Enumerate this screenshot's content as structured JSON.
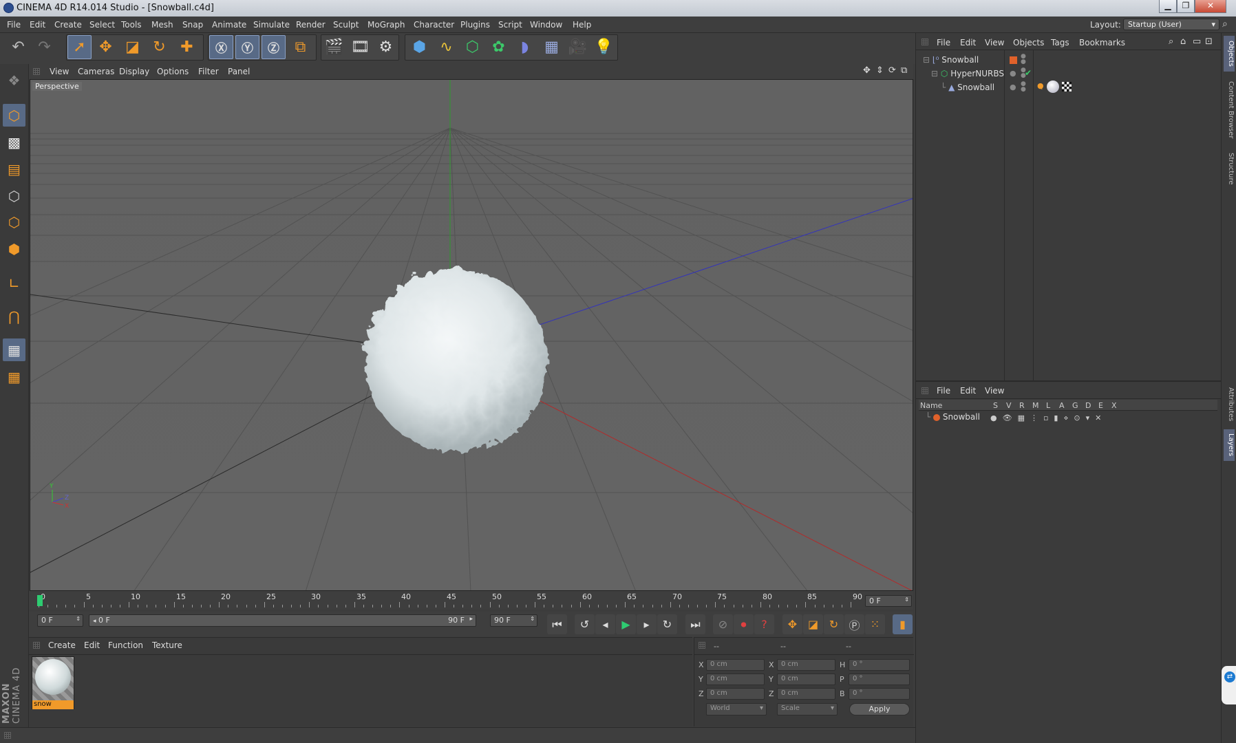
{
  "window": {
    "title": "CINEMA 4D R14.014 Studio - [Snowball.c4d]"
  },
  "menu": [
    "File",
    "Edit",
    "Create",
    "Select",
    "Tools",
    "Mesh",
    "Snap",
    "Animate",
    "Simulate",
    "Render",
    "Sculpt",
    "MoGraph",
    "Character",
    "Plugins",
    "Script",
    "Window",
    "Help"
  ],
  "layout": {
    "label": "Layout:",
    "value": "Startup (User)"
  },
  "viewport": {
    "menu": [
      "View",
      "Cameras",
      "Display",
      "Options",
      "Filter",
      "Panel"
    ],
    "label": "Perspective",
    "axis_y": "Y",
    "axis_z": "Z",
    "axis_x": "X"
  },
  "timeline": {
    "ticks": [
      "0",
      "5",
      "10",
      "15",
      "20",
      "25",
      "30",
      "35",
      "40",
      "45",
      "50",
      "55",
      "60",
      "65",
      "70",
      "75",
      "80",
      "85",
      "90"
    ],
    "current_frame": "0 F",
    "start_field": "0 F",
    "range_start": "0 F",
    "range_end": "90 F",
    "end_field": "90 F"
  },
  "material_manager": {
    "menu": [
      "Create",
      "Edit",
      "Function",
      "Texture"
    ],
    "material_name": "snow"
  },
  "coordinates": {
    "headers": [
      "--",
      "--",
      "--"
    ],
    "rows": [
      {
        "a": "X",
        "av": "0 cm",
        "b": "X",
        "bv": "0 cm",
        "c": "H",
        "cv": "0 °"
      },
      {
        "a": "Y",
        "av": "0 cm",
        "b": "Y",
        "bv": "0 cm",
        "c": "P",
        "cv": "0 °"
      },
      {
        "a": "Z",
        "av": "0 cm",
        "b": "Z",
        "bv": "0 cm",
        "c": "B",
        "cv": "0 °"
      }
    ],
    "mode1": "World",
    "mode2": "Scale",
    "apply": "Apply"
  },
  "object_manager": {
    "menu": [
      "File",
      "Edit",
      "View",
      "Objects",
      "Tags",
      "Bookmarks"
    ],
    "objects": [
      {
        "name": "Snowball",
        "indent": 0
      },
      {
        "name": "HyperNURBS",
        "indent": 1
      },
      {
        "name": "Snowball",
        "indent": 2
      }
    ]
  },
  "layer_manager": {
    "menu": [
      "File",
      "Edit",
      "View"
    ],
    "columns": [
      "Name",
      "S",
      "V",
      "R",
      "M",
      "L",
      "A",
      "G",
      "D",
      "E",
      "X"
    ],
    "layers": [
      {
        "name": "Snowball"
      }
    ]
  },
  "side_tabs": [
    "Objects",
    "Content Browser",
    "Structure",
    "Attributes",
    "Layers"
  ],
  "branding": {
    "maxon": "MAXON",
    "c4d": "CINEMA 4D"
  },
  "colors": {
    "accent_orange": "#f09a2a",
    "layer_orange": "#e0612a",
    "active_blue": "#586a86",
    "axis_red": "#c33",
    "axis_blue": "#44c",
    "axis_green": "#3a3"
  }
}
